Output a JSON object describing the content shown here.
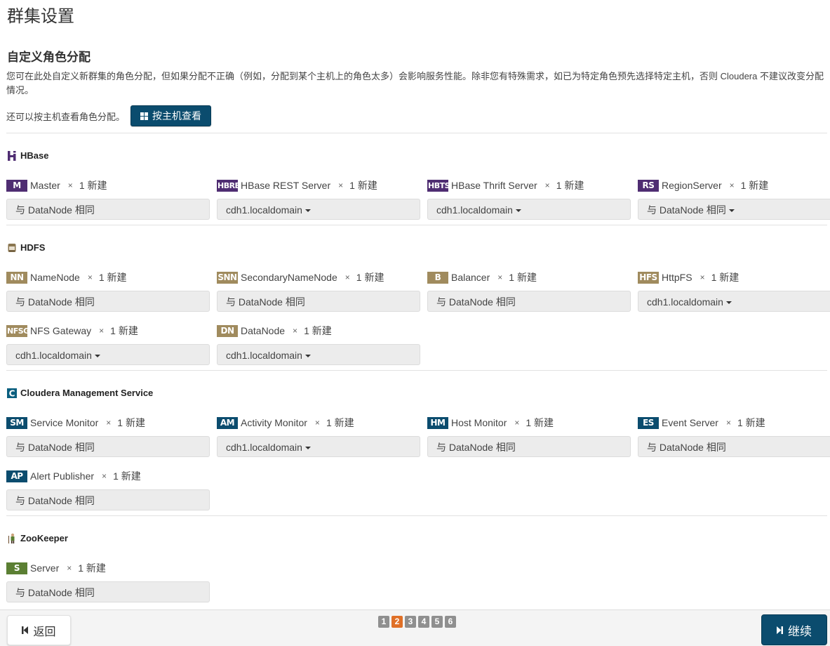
{
  "page": {
    "title": "群集设置",
    "section_title": "自定义角色分配",
    "description": "您可在此处自定义新群集的角色分配，但如果分配不正确（例如，分配到某个主机上的角色太多）会影响服务性能。除非您有特殊需求，如已为特定角色预先选择特定主机，否则 Cloudera 不建议改变分配情况。",
    "by_host_text": "还可以按主机查看角色分配。",
    "by_host_button": "按主机查看"
  },
  "colors": {
    "hbase": "#4f2d72",
    "hdfs": "#a08b5e",
    "mgmt": "#0b4c6e",
    "zookeeper": "#5b7f33",
    "primary": "#0b4c6e",
    "pager_active": "#e07027",
    "pager_inactive": "#8f8f8f"
  },
  "services": [
    {
      "name": "HBase",
      "icon": "hbase-icon",
      "roles": [
        {
          "badge": "M",
          "name": "Master",
          "times": "×",
          "count": "1 新建",
          "host": "与 DataNode 相同",
          "dropdown": false
        },
        {
          "badge": "HBRE",
          "name": "HBase REST Server",
          "times": "×",
          "count": "1 新建",
          "host": "cdh1.localdomain",
          "dropdown": true
        },
        {
          "badge": "HBTS",
          "name": "HBase Thrift Server",
          "times": "×",
          "count": "1 新建",
          "host": "cdh1.localdomain",
          "dropdown": true
        },
        {
          "badge": "RS",
          "name": "RegionServer",
          "times": "×",
          "count": "1 新建",
          "host": "与 DataNode 相同",
          "dropdown": true
        }
      ]
    },
    {
      "name": "HDFS",
      "icon": "hdfs-icon",
      "roles": [
        {
          "badge": "NN",
          "name": "NameNode",
          "times": "×",
          "count": "1 新建",
          "host": "与 DataNode 相同",
          "dropdown": false
        },
        {
          "badge": "SNN",
          "name": "SecondaryNameNode",
          "times": "×",
          "count": "1 新建",
          "host": "与 DataNode 相同",
          "dropdown": false
        },
        {
          "badge": "B",
          "name": "Balancer",
          "times": "×",
          "count": "1 新建",
          "host": "与 DataNode 相同",
          "dropdown": false
        },
        {
          "badge": "HFS",
          "name": "HttpFS",
          "times": "×",
          "count": "1 新建",
          "host": "cdh1.localdomain",
          "dropdown": true
        },
        {
          "badge": "NFSG",
          "name": "NFS Gateway",
          "times": "×",
          "count": "1 新建",
          "host": "cdh1.localdomain",
          "dropdown": true
        },
        {
          "badge": "DN",
          "name": "DataNode",
          "times": "×",
          "count": "1 新建",
          "host": "cdh1.localdomain",
          "dropdown": true
        }
      ]
    },
    {
      "name": "Cloudera Management Service",
      "icon": "cloudera-icon",
      "roles": [
        {
          "badge": "SM",
          "name": "Service Monitor",
          "times": "×",
          "count": "1 新建",
          "host": "与 DataNode 相同",
          "dropdown": false
        },
        {
          "badge": "AM",
          "name": "Activity Monitor",
          "times": "×",
          "count": "1 新建",
          "host": "cdh1.localdomain",
          "dropdown": true
        },
        {
          "badge": "HM",
          "name": "Host Monitor",
          "times": "×",
          "count": "1 新建",
          "host": "与 DataNode 相同",
          "dropdown": false
        },
        {
          "badge": "ES",
          "name": "Event Server",
          "times": "×",
          "count": "1 新建",
          "host": "与 DataNode 相同",
          "dropdown": false
        },
        {
          "badge": "AP",
          "name": "Alert Publisher",
          "times": "×",
          "count": "1 新建",
          "host": "与 DataNode 相同",
          "dropdown": false
        }
      ]
    },
    {
      "name": "ZooKeeper",
      "icon": "zookeeper-icon",
      "roles": [
        {
          "badge": "S",
          "name": "Server",
          "times": "×",
          "count": "1 新建",
          "host": "与 DataNode 相同",
          "dropdown": false
        }
      ]
    }
  ],
  "footer": {
    "back_label": "返回",
    "continue_label": "继续",
    "pages": [
      "1",
      "2",
      "3",
      "4",
      "5",
      "6"
    ],
    "current_page": "2"
  }
}
